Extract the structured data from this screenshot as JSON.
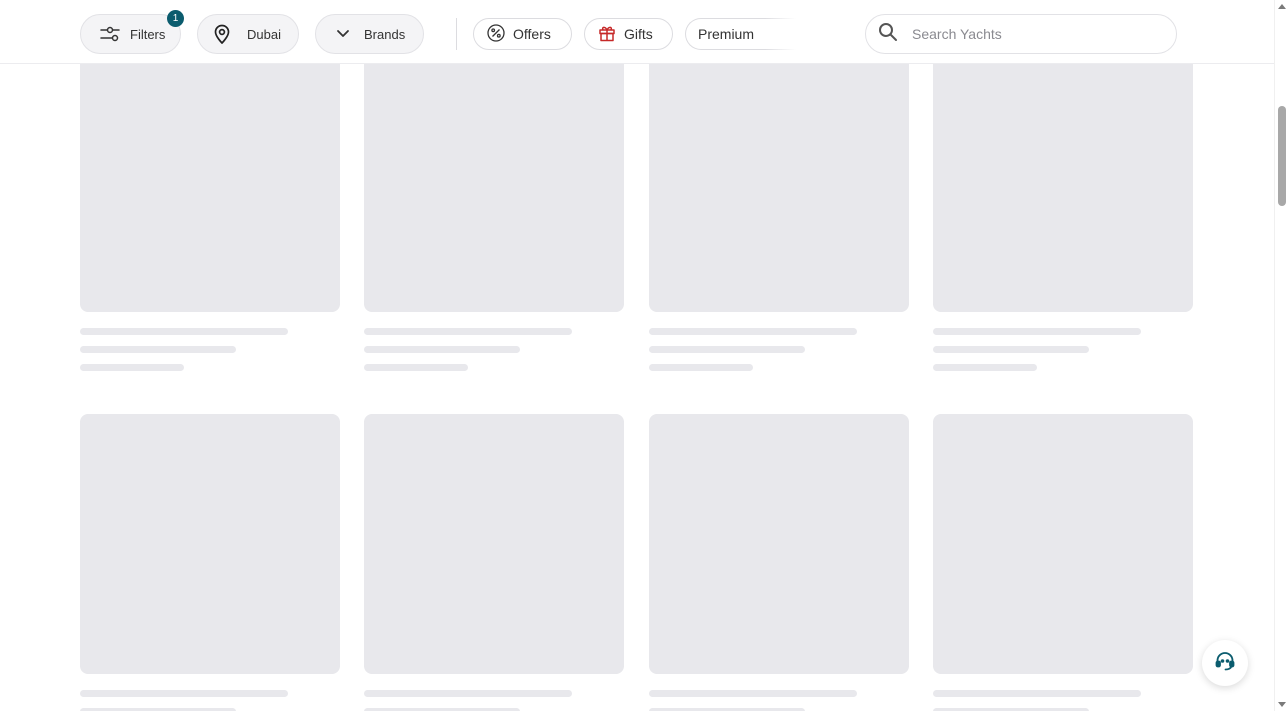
{
  "toolbar": {
    "filters_label": "Filters",
    "filters_count": "1",
    "location_label": "Dubai",
    "brands_label": "Brands",
    "offers_label": "Offers",
    "gifts_label": "Gifts",
    "premium_label": "Premium"
  },
  "search": {
    "placeholder": "Search Yachts",
    "value": ""
  },
  "icons": {
    "filters": "sliders-icon",
    "location": "map-pin-icon",
    "brands": "chevron-down-icon",
    "offers": "percent-icon",
    "gifts": "gift-icon",
    "search": "search-icon",
    "support": "headset-icon"
  },
  "colors": {
    "accent": "#0b5c6e",
    "gift": "#c62828",
    "skeleton": "#e8e8ec",
    "support": "#0b5c6e"
  },
  "listing": {
    "columns": 4,
    "rows_visible": 2,
    "state": "loading"
  }
}
